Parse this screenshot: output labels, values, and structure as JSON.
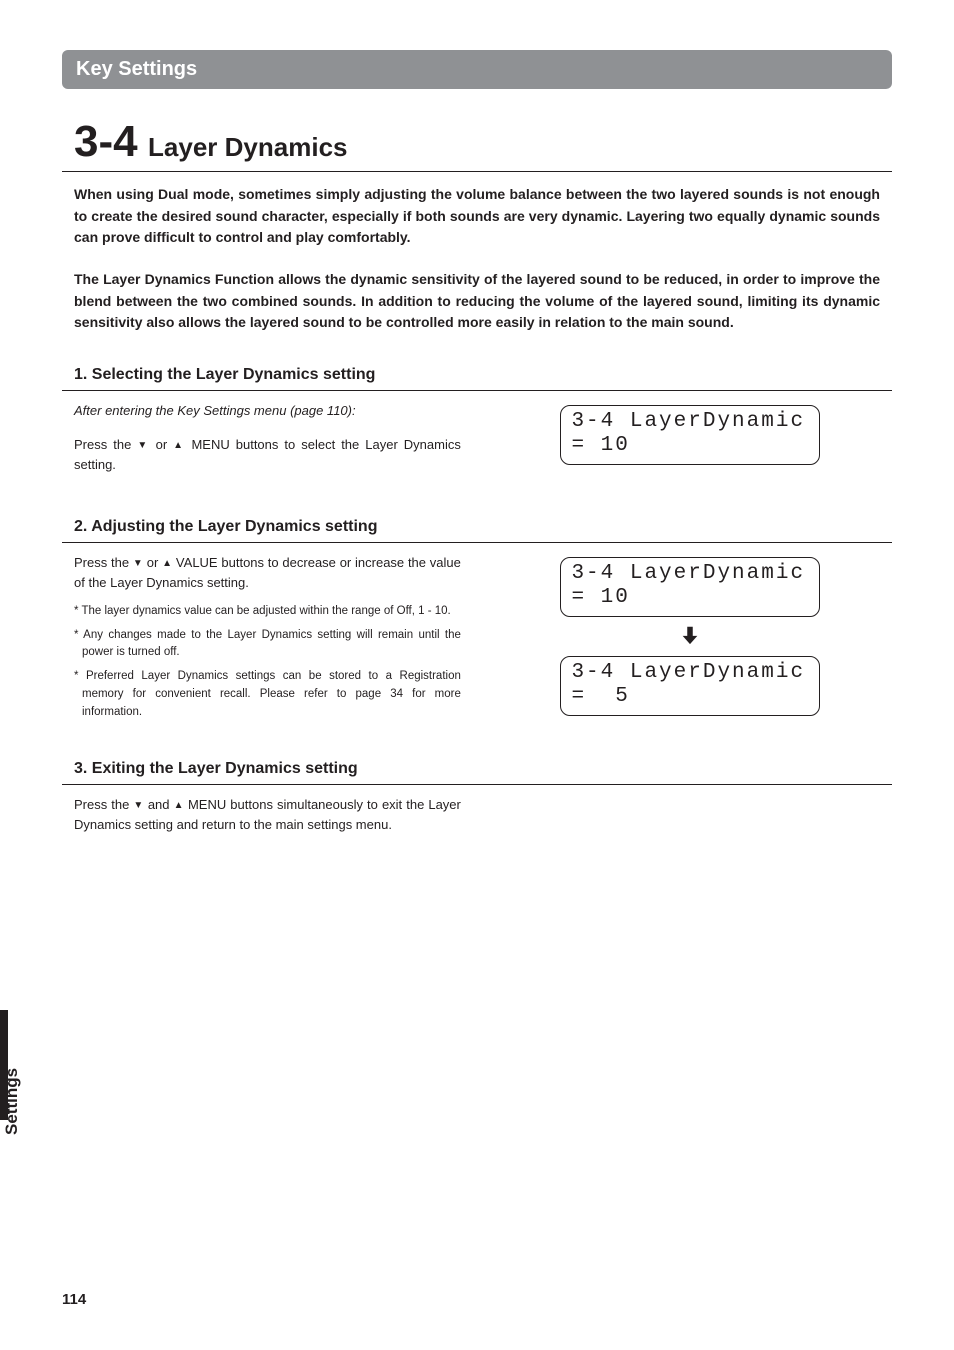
{
  "header": {
    "title": "Key Settings"
  },
  "section": {
    "number": "3-4",
    "title": "Layer Dynamics"
  },
  "intro": {
    "p1": "When using Dual mode, sometimes simply adjusting the volume balance between the two layered sounds is not enough to create the desired sound character, especially if both sounds are very dynamic.  Layering two equally dynamic sounds can prove difficult to control and play comfortably.",
    "p2": "The Layer Dynamics Function allows the dynamic sensitivity of the layered sound to be reduced, in order to improve the blend between the two combined sounds.  In addition to reducing the volume of the layered sound, limiting its dynamic sensitivity also allows the layered sound to be controlled more easily in relation to the main sound."
  },
  "step1": {
    "heading": "1. Selecting the Layer Dynamics setting",
    "after": "After entering the Key Settings menu (page 110):",
    "body_a": "Press the ",
    "body_b": " or ",
    "body_c": " MENU buttons to select the Layer Dynamics setting.",
    "lcd": "3-4 LayerDynamic\n= 10"
  },
  "step2": {
    "heading": "2. Adjusting the Layer Dynamics setting",
    "body_a": "Press the ",
    "body_b": " or ",
    "body_c": " VALUE buttons to decrease or increase the value of the Layer Dynamics setting.",
    "note1": "* The layer dynamics value can be adjusted within the range of Off, 1 - 10.",
    "note2": "* Any changes made to the Layer Dynamics setting will remain until the power is turned off.",
    "note3": "* Preferred Layer Dynamics settings can be stored to a Registration memory for convenient recall.  Please refer to page 34 for more information.",
    "lcd_before": "3-4 LayerDynamic\n= 10",
    "lcd_after": "3-4 LayerDynamic\n=  5"
  },
  "step3": {
    "heading": "3. Exiting the Layer Dynamics setting",
    "body_a": "Press the ",
    "body_b": " and ",
    "body_c": " MENU buttons simultaneously to exit the Layer Dynamics setting and return to the main settings menu."
  },
  "glyphs": {
    "down": "▼",
    "up": "▲"
  },
  "sideTab": "Settings",
  "pageNumber": "114"
}
